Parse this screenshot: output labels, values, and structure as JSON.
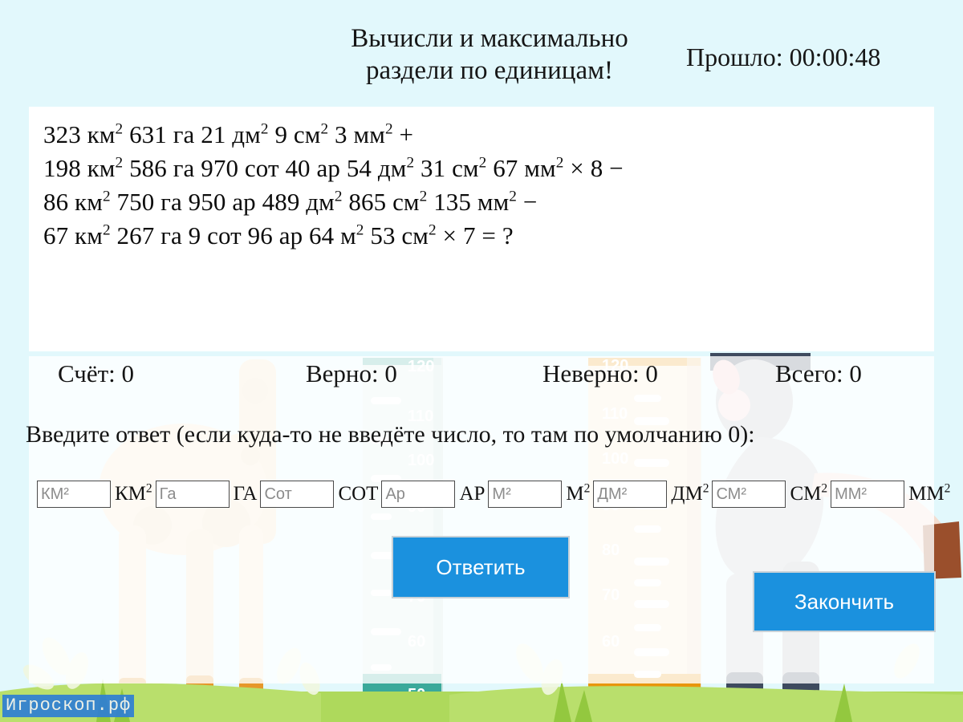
{
  "header": {
    "task_title_line1": "Вычисли и максимально",
    "task_title_line2": "раздели по единицам!",
    "timer_label": "Прошло: 00:00:48"
  },
  "expression": {
    "lines": [
      "323 км² 631 га 21 дм² 9 см² 3 мм² +",
      "198 км² 586 га 970 сот 40 ар 54 дм² 31 см² 67 мм²   ×   8 −",
      "86 км² 750 га 950 ар 489 дм² 865 см² 135 мм² −",
      "67 км² 267 га 9 сот 96 ар 64 м² 53 см²   ×   7 =     ?"
    ]
  },
  "stats": {
    "score": "Счёт: 0",
    "correct": "Верно: 0",
    "incorrect": "Неверно: 0",
    "total": "Всего: 0"
  },
  "instruction": "Введите ответ (если куда-то не введёте число, то там по умолчанию 0):",
  "answer_fields": [
    {
      "placeholder": "КМ²",
      "value": "",
      "label": "КМ²"
    },
    {
      "placeholder": "Га",
      "value": "",
      "label": "ГА"
    },
    {
      "placeholder": "Сот",
      "value": "",
      "label": "СОТ"
    },
    {
      "placeholder": "Ар",
      "value": "",
      "label": "АР"
    },
    {
      "placeholder": "М²",
      "value": "",
      "label": "М²"
    },
    {
      "placeholder": "ДМ²",
      "value": "",
      "label": "ДМ²"
    },
    {
      "placeholder": "СМ²",
      "value": "",
      "label": "СМ²"
    },
    {
      "placeholder": "ММ²",
      "value": "",
      "label": "ММ²"
    }
  ],
  "buttons": {
    "answer": "Ответить",
    "finish": "Закончить"
  },
  "watermark": "Игроскоп.рф",
  "ruler_ticks": [
    "120",
    "110",
    "100",
    "90",
    "80",
    "70",
    "60",
    "50"
  ],
  "colors": {
    "page_background": "#e2f8fc",
    "panel_background": "#ffffff",
    "button_blue": "#1b91de",
    "button_text": "#ffffff",
    "text": "#121212",
    "ruler_teal": "#3aa99a",
    "ruler_orange": "#e8960c",
    "watermark_background": "#2f7fd4"
  }
}
